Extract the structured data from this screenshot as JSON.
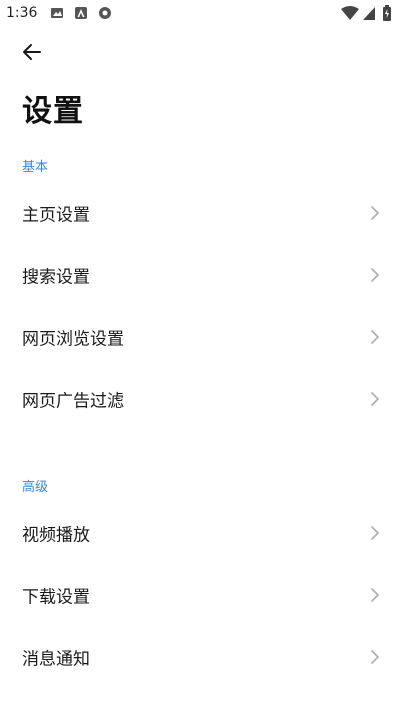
{
  "status_bar": {
    "time": "1:36"
  },
  "header": {
    "title": "设置"
  },
  "sections": [
    {
      "header": "基本",
      "items": [
        {
          "label": "主页设置"
        },
        {
          "label": "搜索设置"
        },
        {
          "label": "网页浏览设置"
        },
        {
          "label": "网页广告过滤"
        }
      ]
    },
    {
      "header": "高级",
      "items": [
        {
          "label": "视频播放"
        },
        {
          "label": "下载设置"
        },
        {
          "label": "消息通知"
        }
      ]
    }
  ],
  "colors": {
    "accent": "#3a86d8",
    "chevron": "#b0b0b0"
  },
  "icons": {
    "back": "arrow-left-icon",
    "row": "chevron-right-icon"
  }
}
